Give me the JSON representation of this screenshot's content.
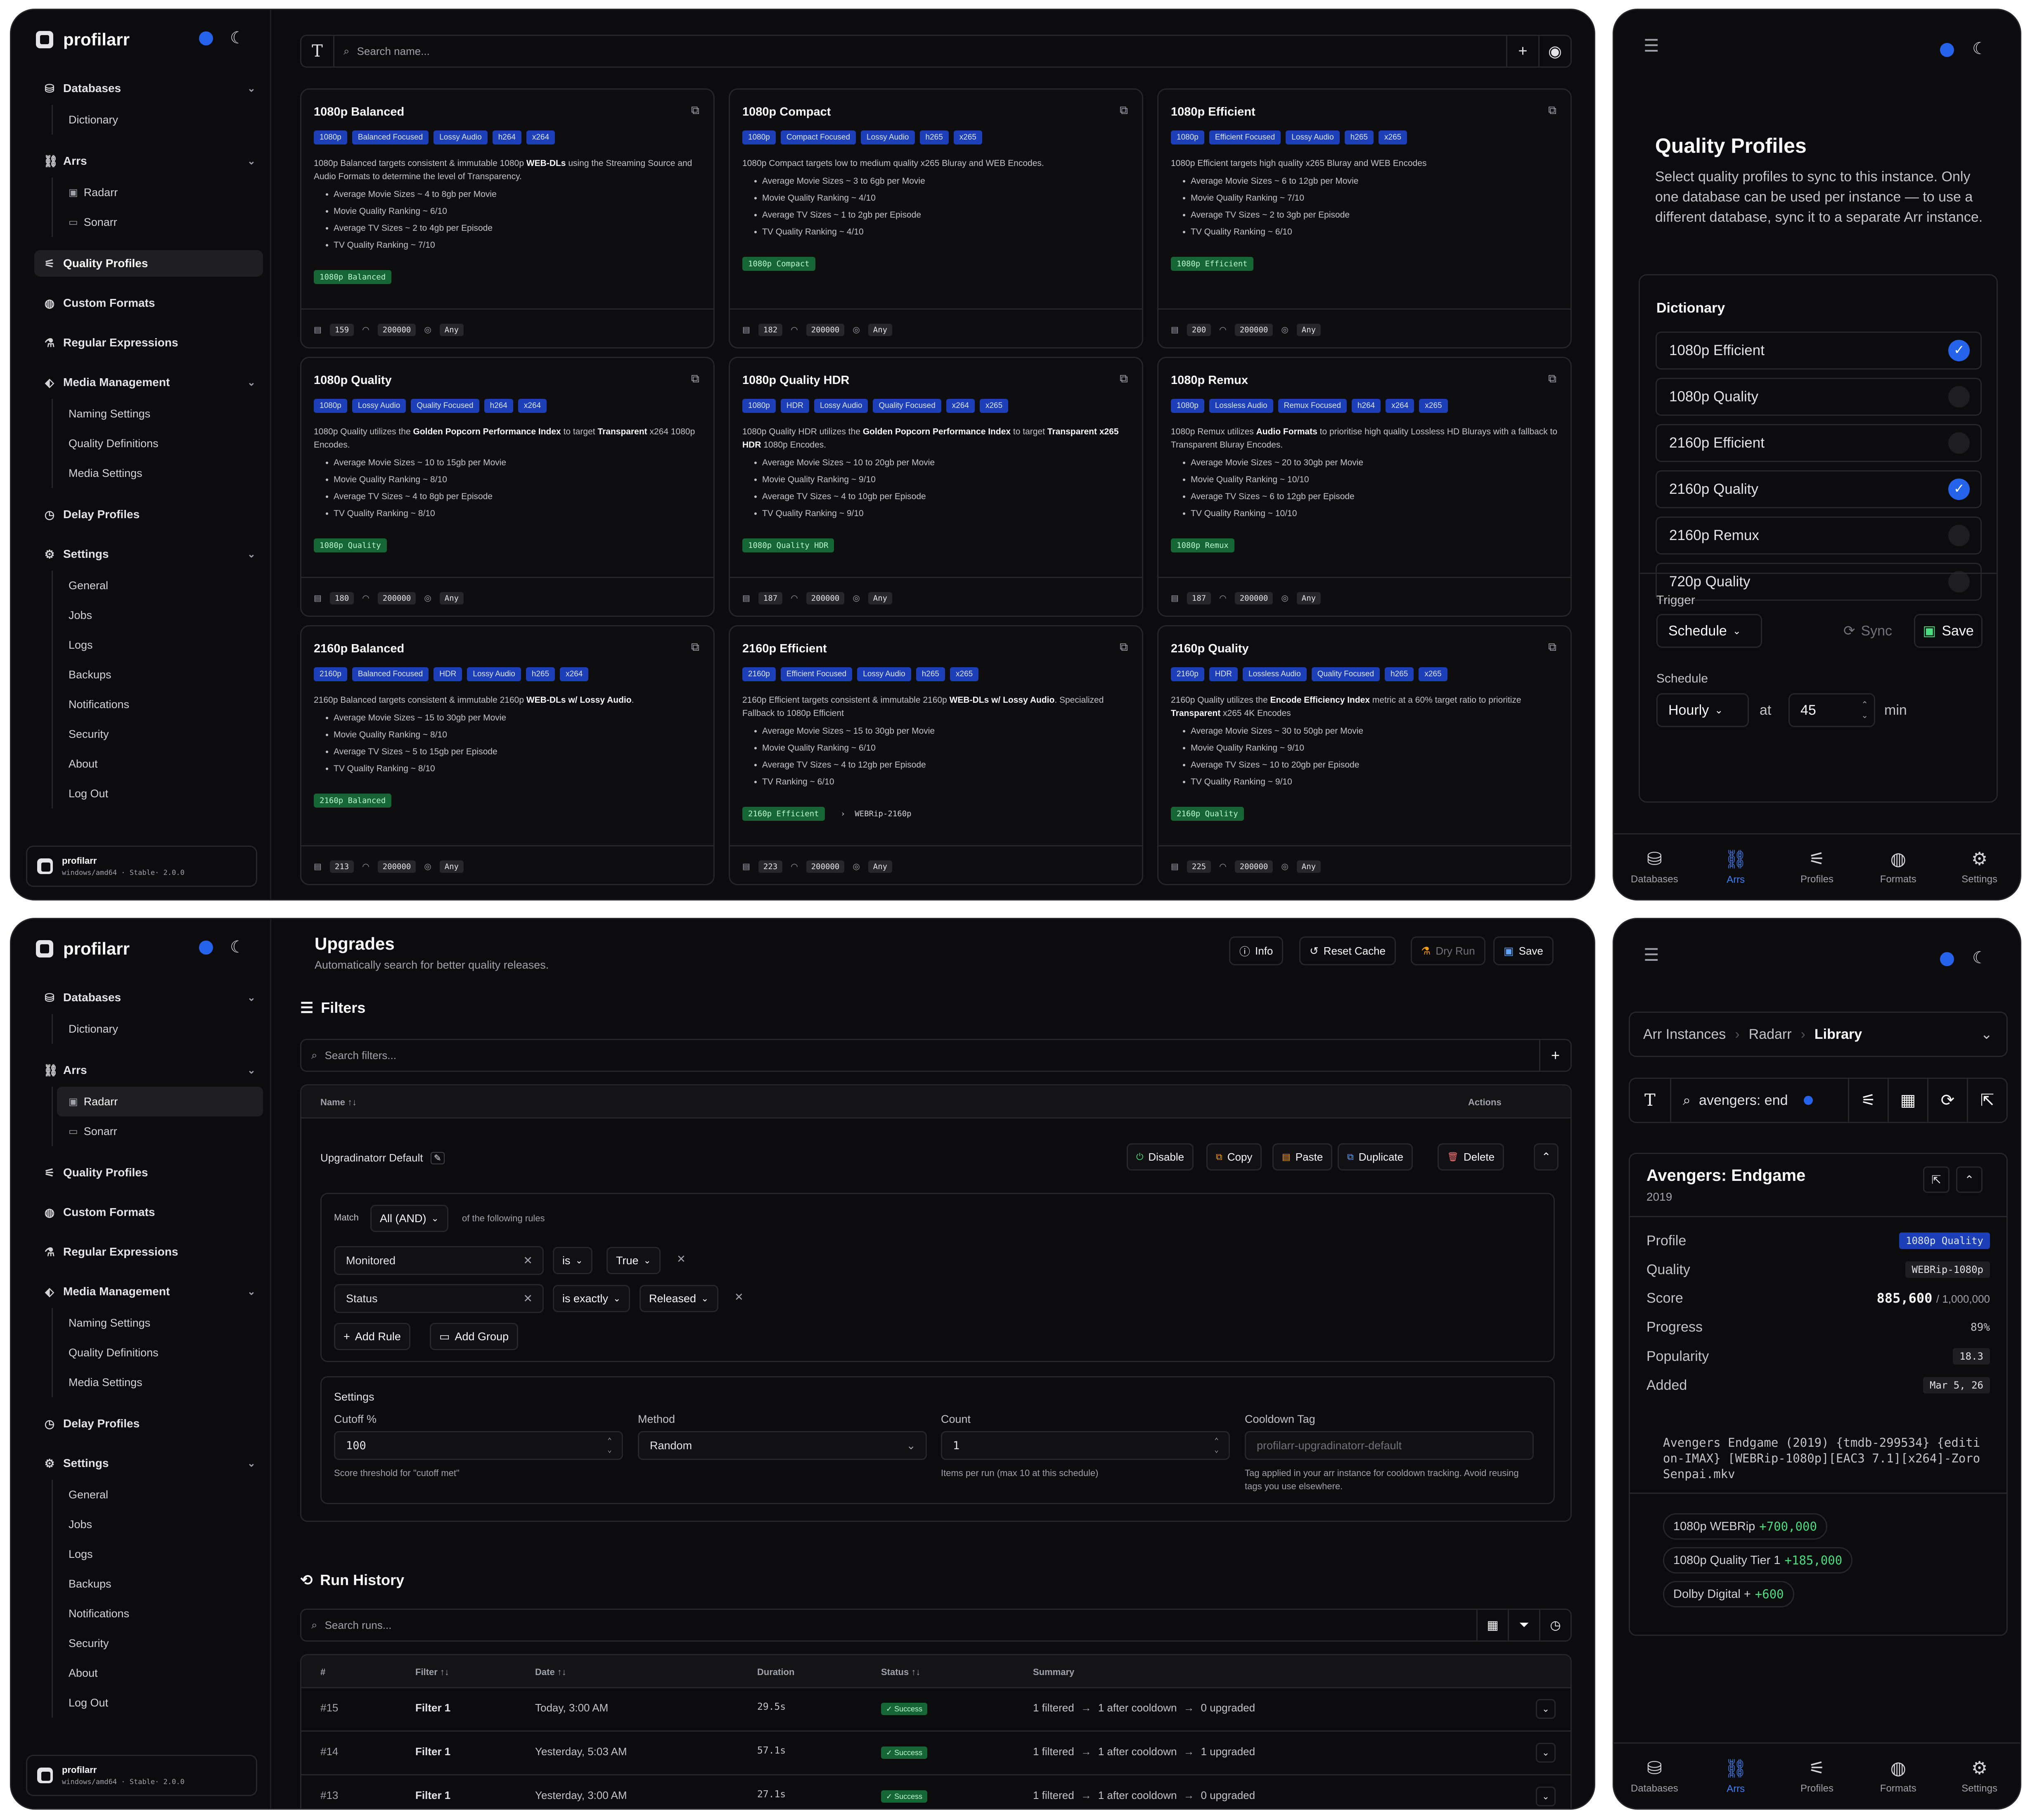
{
  "brand": {
    "name": "profilarr",
    "version_name": "profilarr",
    "version_sub": "windows/amd64 · Stable· 2.0.0"
  },
  "sidebar": {
    "groups": [
      {
        "label": "Databases",
        "icon": "database-icon",
        "children": [
          "Dictionary"
        ]
      },
      {
        "label": "Arrs",
        "icon": "link-icon",
        "children": [
          "Radarr",
          "Sonarr"
        ]
      },
      {
        "label": "Quality Profiles",
        "icon": "sliders-icon",
        "children": []
      },
      {
        "label": "Custom Formats",
        "icon": "palette-icon",
        "children": []
      },
      {
        "label": "Regular Expressions",
        "icon": "regex-icon",
        "children": []
      },
      {
        "label": "Media Management",
        "icon": "tag-icon",
        "children": [
          "Naming Settings",
          "Quality Definitions",
          "Media Settings"
        ]
      },
      {
        "label": "Delay Profiles",
        "icon": "clock-icon",
        "children": []
      },
      {
        "label": "Settings",
        "icon": "gear-icon",
        "children": [
          "General",
          "Jobs",
          "Logs",
          "Backups",
          "Notifications",
          "Security",
          "About",
          "Log Out"
        ]
      }
    ]
  },
  "profiles_page": {
    "search_placeholder": "Search name...",
    "cards": [
      {
        "title": "1080p Balanced",
        "tags": [
          "1080p",
          "Balanced Focused",
          "Lossy Audio",
          "h264",
          "x264"
        ],
        "desc_html": "1080p Balanced targets consistent &amp; immutable 1080p <b>WEB-DLs</b> using the Streaming Source and Audio Formats to determine the level of Transparency.",
        "bullets": [
          "Average Movie Sizes ~ 4 to 8gb per Movie",
          "Movie Quality Ranking ~ 6/10",
          "Average TV Sizes ~ 2 to 4gb per Episode",
          "TV Quality Ranking ~ 7/10"
        ],
        "badge": "1080p Balanced",
        "badge2": "",
        "count": "159",
        "score": "200000",
        "lang": "Any"
      },
      {
        "title": "1080p Compact",
        "tags": [
          "1080p",
          "Compact Focused",
          "Lossy Audio",
          "h265",
          "x265"
        ],
        "desc_html": "1080p Compact targets low to medium quality x265 Bluray and WEB Encodes.",
        "bullets": [
          "Average Movie Sizes ~ 3 to 6gb per Movie",
          "Movie Quality Ranking ~ 4/10",
          "Average TV Sizes ~ 1 to 2gb per Episode",
          "TV Quality Ranking ~ 4/10"
        ],
        "badge": "1080p Compact",
        "badge2": "",
        "count": "182",
        "score": "200000",
        "lang": "Any"
      },
      {
        "title": "1080p Efficient",
        "tags": [
          "1080p",
          "Efficient Focused",
          "Lossy Audio",
          "h265",
          "x265"
        ],
        "desc_html": "1080p Efficient targets high quality x265 Bluray and WEB Encodes",
        "bullets": [
          "Average Movie Sizes ~ 6 to 12gb per Movie",
          "Movie Quality Ranking ~ 7/10",
          "Average TV Sizes ~ 2 to 3gb per Episode",
          "TV Quality Ranking ~ 6/10"
        ],
        "badge": "1080p Efficient",
        "badge2": "",
        "count": "200",
        "score": "200000",
        "lang": "Any"
      },
      {
        "title": "1080p Quality",
        "tags": [
          "1080p",
          "Lossy Audio",
          "Quality Focused",
          "h264",
          "x264"
        ],
        "desc_html": "1080p Quality utilizes the <b>Golden Popcorn Performance Index</b> to target <b>Transparent</b> x264 1080p Encodes.",
        "bullets": [
          "Average Movie Sizes ~ 10 to 15gb per Movie",
          "Movie Quality Ranking ~ 8/10",
          "Average TV Sizes ~ 4 to 8gb per Episode",
          "TV Quality Ranking ~ 8/10"
        ],
        "badge": "1080p Quality",
        "badge2": "",
        "count": "180",
        "score": "200000",
        "lang": "Any"
      },
      {
        "title": "1080p Quality HDR",
        "tags": [
          "1080p",
          "HDR",
          "Lossy Audio",
          "Quality Focused",
          "x264",
          "x265"
        ],
        "desc_html": "1080p Quality HDR utilizes the <b>Golden Popcorn Performance Index</b> to target <b>Transparent x265 HDR</b> 1080p Encodes.",
        "bullets": [
          "Average Movie Sizes ~ 10 to 20gb per Movie",
          "Movie Quality Ranking ~ 9/10",
          "Average TV Sizes ~ 4 to 10gb per Episode",
          "TV Quality Ranking ~ 9/10"
        ],
        "badge": "1080p Quality HDR",
        "badge2": "",
        "count": "187",
        "score": "200000",
        "lang": "Any"
      },
      {
        "title": "1080p Remux",
        "tags": [
          "1080p",
          "Lossless Audio",
          "Remux Focused",
          "h264",
          "x264",
          "x265"
        ],
        "desc_html": "1080p Remux utilizes <b>Audio Formats</b> to prioritise high quality Lossless HD Blurays with a fallback to Transparent Bluray Encodes.",
        "bullets": [
          "Average Movie Sizes ~ 20 to 30gb per Movie",
          "Movie Quality Ranking ~ 10/10",
          "Average TV Sizes ~ 6 to 12gb per Episode",
          "TV Quality Ranking ~ 10/10"
        ],
        "badge": "1080p Remux",
        "badge2": "",
        "count": "187",
        "score": "200000",
        "lang": "Any"
      },
      {
        "title": "2160p Balanced",
        "tags": [
          "2160p",
          "Balanced Focused",
          "HDR",
          "Lossy Audio",
          "h265",
          "x264"
        ],
        "desc_html": "2160p Balanced targets consistent &amp; immutable 2160p <b>WEB-DLs w/ Lossy Audio</b>.",
        "bullets": [
          "Average Movie Sizes ~ 15 to 30gb per Movie",
          "Movie Quality Ranking ~ 8/10",
          "Average TV Sizes ~ 5 to 15gb per Episode",
          "TV Quality Ranking ~ 8/10"
        ],
        "badge": "2160p Balanced",
        "badge2": "",
        "count": "213",
        "score": "200000",
        "lang": "Any"
      },
      {
        "title": "2160p Efficient",
        "tags": [
          "2160p",
          "Efficient Focused",
          "Lossy Audio",
          "h265",
          "x265"
        ],
        "desc_html": "2160p Efficient targets consistent &amp; immutable 2160p <b>WEB-DLs w/ Lossy Audio</b>. Specialized Fallback to 1080p Efficient",
        "bullets": [
          "Average Movie Sizes ~ 15 to 30gb per Movie",
          "Movie Quality Ranking ~ 6/10",
          "Average TV Sizes ~ 4 to 12gb per Episode",
          "TV Ranking ~ 6/10"
        ],
        "badge": "2160p Efficient",
        "badge2": "WEBRip-2160p",
        "count": "223",
        "score": "200000",
        "lang": "Any"
      },
      {
        "title": "2160p Quality",
        "tags": [
          "2160p",
          "HDR",
          "Lossless Audio",
          "Quality Focused",
          "h265",
          "x265"
        ],
        "desc_html": "2160p Quality utilizes the <b>Encode Efficiency Index</b> metric at a 60% target ratio to prioritize <b>Transparent</b> x265 4K Encodes",
        "bullets": [
          "Average Movie Sizes ~ 30 to 50gb per Movie",
          "Movie Quality Ranking ~ 9/10",
          "Average TV Sizes ~ 10 to 20gb per Episode",
          "TV Quality Ranking ~ 9/10"
        ],
        "badge": "2160p Quality",
        "badge2": "",
        "count": "225",
        "score": "200000",
        "lang": "Any"
      }
    ]
  },
  "sync_panel": {
    "title": "Quality Profiles",
    "desc": "Select quality profiles to sync to this instance. Only one database can be used per instance — to use a different database, sync it to a separate Arr instance.",
    "section": "Dictionary",
    "options": [
      {
        "label": "1080p Efficient",
        "checked": true
      },
      {
        "label": "1080p Quality",
        "checked": false
      },
      {
        "label": "2160p Efficient",
        "checked": false
      },
      {
        "label": "2160p Quality",
        "checked": true
      },
      {
        "label": "2160p Remux",
        "checked": false
      },
      {
        "label": "720p Quality",
        "checked": false
      }
    ],
    "trigger_label": "Trigger",
    "trigger_value": "Schedule",
    "sync_label": "Sync",
    "save_label": "Save",
    "schedule_label": "Schedule",
    "schedule_value": "Hourly",
    "at_label": "at",
    "minute_value": "45",
    "min_label": "min"
  },
  "bottom_nav": [
    {
      "label": "Databases",
      "icon": "database-icon",
      "active": false
    },
    {
      "label": "Arrs",
      "icon": "link-icon",
      "active": true
    },
    {
      "label": "Profiles",
      "icon": "sliders-icon",
      "active": false
    },
    {
      "label": "Formats",
      "icon": "palette-icon",
      "active": false
    },
    {
      "label": "Settings",
      "icon": "gear-icon",
      "active": false
    }
  ],
  "upgrades": {
    "title": "Upgrades",
    "subtitle": "Automatically search for better quality releases.",
    "buttons": {
      "info": "Info",
      "reset": "Reset Cache",
      "dry": "Dry Run",
      "save": "Save"
    },
    "filters_title": "Filters",
    "filters_search": "Search filters...",
    "col_name": "Name ↑↓",
    "col_actions": "Actions",
    "filter_name": "Upgradinatorr Default",
    "row_actions": [
      "Disable",
      "Copy",
      "Paste",
      "Duplicate",
      "Delete"
    ],
    "match_label": "Match",
    "match_value": "All (AND)",
    "match_suffix": "of the following rules",
    "rules": [
      {
        "field": "Monitored",
        "op": "is",
        "value": "True"
      },
      {
        "field": "Status",
        "op": "is exactly",
        "value": "Released"
      }
    ],
    "add_rule": "Add Rule",
    "add_group": "Add Group",
    "settings_title": "Settings",
    "cutoff_label": "Cutoff %",
    "cutoff_value": "100",
    "cutoff_hint": "Score threshold for \"cutoff met\"",
    "method_label": "Method",
    "method_value": "Random",
    "count_label": "Count",
    "count_value": "1",
    "count_hint": "Items per run (max 10 at this schedule)",
    "cooldown_label": "Cooldown Tag",
    "cooldown_placeholder": "profilarr-upgradinatorr-default",
    "cooldown_hint": "Tag applied in your arr instance for cooldown tracking. Avoid reusing tags you use elsewhere.",
    "history_title": "Run History",
    "history_search": "Search runs...",
    "history_cols": {
      "num": "#",
      "filter": "Filter ↑↓",
      "date": "Date ↑↓",
      "duration": "Duration",
      "status": "Status ↑↓",
      "summary": "Summary"
    },
    "runs": [
      {
        "num": "#15",
        "filter": "Filter 1",
        "date": "Today, 3:00 AM",
        "duration": "29.5s",
        "status": "✓ Success",
        "filtered": "1 filtered",
        "cooldown": "1 after cooldown",
        "upgraded": "0 upgraded"
      },
      {
        "num": "#14",
        "filter": "Filter 1",
        "date": "Yesterday, 5:03 AM",
        "duration": "57.1s",
        "status": "✓ Success",
        "filtered": "1 filtered",
        "cooldown": "1 after cooldown",
        "upgraded": "1 upgraded"
      },
      {
        "num": "#13",
        "filter": "Filter 1",
        "date": "Yesterday, 3:00 AM",
        "duration": "27.1s",
        "status": "✓ Success",
        "filtered": "1 filtered",
        "cooldown": "1 after cooldown",
        "upgraded": "0 upgraded"
      }
    ]
  },
  "library": {
    "crumbs": [
      "Arr Instances",
      "Radarr",
      "Library"
    ],
    "search_value": "avengers: end",
    "movie_title": "Avengers: Endgame",
    "year": "2019",
    "rows": [
      {
        "k": "Profile",
        "v": "1080p Quality"
      },
      {
        "k": "Quality",
        "v": "WEBRip-1080p"
      },
      {
        "k": "Score",
        "v": "885,600"
      },
      {
        "k": "Progress",
        "v": "89%"
      },
      {
        "k": "Popularity",
        "v": "18.3"
      },
      {
        "k": "Added",
        "v": "Mar 5, 26"
      }
    ],
    "score_max": "/ 1,000,000",
    "filename": "Avengers Endgame (2019) {tmdb-299534} {edition-IMAX} [WEBRip-1080p][EAC3 7.1][x264]-ZoroSenpai.mkv",
    "chips": [
      {
        "label": "1080p WEBRip",
        "points": "+700,000"
      },
      {
        "label": "1080p Quality Tier 1",
        "points": "+185,000"
      },
      {
        "label": "Dolby Digital +",
        "points": "+600"
      }
    ]
  }
}
